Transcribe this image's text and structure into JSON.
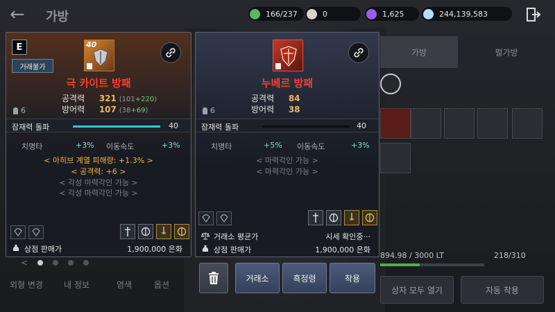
{
  "header": {
    "back_icon": "back-arrow-icon",
    "title": "가방",
    "resources": [
      {
        "icon": "energy-icon",
        "color": "#5bb85b",
        "value": "166/237"
      },
      {
        "icon": "pearl-icon",
        "color": "#d9d3cc",
        "value": "0"
      },
      {
        "icon": "crystal-icon",
        "color": "#9a5cf0",
        "value": "1,625"
      },
      {
        "icon": "silver-icon",
        "color": "#b9dcf5",
        "value": "244,139,583"
      }
    ],
    "exit_icon": "exit-door-icon"
  },
  "inventory": {
    "tabs": [
      "가방",
      "펄가방"
    ],
    "weight": "894.98 / 3000 LT",
    "weight_fraction": 0.3,
    "slots": "218/310",
    "buttons": [
      "상자 모두 열기",
      "자동 착용"
    ]
  },
  "left_menu": [
    "외형 변경",
    "내 정보",
    "염색",
    "옵션"
  ],
  "left_item": {
    "grade": "E",
    "trade_badge": "거래불가",
    "enhance": "40",
    "name": "극 카이트 방패",
    "stats": [
      {
        "label": "공격력",
        "value": "321",
        "base": "101",
        "bonus": "+220"
      },
      {
        "label": "방어력",
        "value": "107",
        "base": "38",
        "bonus": "+69"
      }
    ],
    "person_count": "6",
    "awakening_label": "잠재력 돌파",
    "awakening_value": "40",
    "awakening_fraction": 1.0,
    "substats": [
      {
        "label": "치명타",
        "value": "+3%"
      },
      {
        "label": "이동속도",
        "value": "+3%"
      }
    ],
    "bonus_lines": [
      "< 아히브 계열 피해량: +1.3% >",
      "< 공격력: +6 >"
    ],
    "locked_lines": [
      "< 각성 마력각인 가능 >",
      "< 각성 마력각인 가능 >"
    ],
    "sell_label": "상점 판매가",
    "sell_value": "1,900,000 은화"
  },
  "right_item": {
    "name": "누베르 방패",
    "stats": [
      {
        "label": "공격력",
        "value": "84"
      },
      {
        "label": "방어력",
        "value": "38"
      }
    ],
    "person_count": "6",
    "awakening_label": "잠재력 돌파",
    "awakening_value": "40",
    "awakening_fraction": 0.0,
    "substats": [
      {
        "label": "치명타",
        "value": "+5%"
      },
      {
        "label": "이동속도",
        "value": "+3%"
      }
    ],
    "locked_lines": [
      "< 마력각인 가능 >",
      "< 마력각인 가능 >"
    ],
    "market_label": "거래소 평균가",
    "market_value": "시세 확인중···",
    "sell_label": "상점 판매가",
    "sell_value": "1,900,000 은화"
  },
  "actions": {
    "delete_icon": "trash-icon",
    "market": "거래소",
    "blacksmith": "흑정령",
    "equip": "착용"
  }
}
